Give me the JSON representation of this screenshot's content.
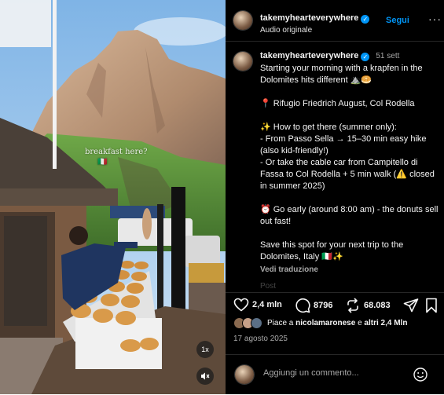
{
  "media": {
    "overlay_line1": "breakfast here?",
    "overlay_line2": "🇮🇹",
    "speed_label": "1x"
  },
  "header": {
    "username": "takemyhearteverywhere",
    "subtitle": "Audio originale",
    "follow_label": "Segui",
    "more_label": "···"
  },
  "caption": {
    "username": "takemyhearteverywhere",
    "time": "51 sett",
    "lines": [
      "Starting your morning with a krapfen in the Dolomites hits different ⛰️🥯",
      "",
      "📍 Rifugio Friedrich August, Col Rodella",
      "",
      "✨ How to get there (summer only):",
      "- From Passo Sella → 15–30 min easy hike (also kid-friendly!)",
      "- Or take the cable car from Campitello di Fassa to Col Rodella + 5 min walk (⚠️ closed in summer 2025)",
      "",
      "⏰ Go early (around 8:00 am) - the donuts sell out fast!",
      "",
      "Save this spot for your next trip to the Dolomites, Italy 🇮🇹✨"
    ],
    "translate_label": "Vedi traduzione",
    "next_faded": "Post"
  },
  "actions": {
    "likes": "2,4 mln",
    "comments": "8796",
    "reposts": "68.083"
  },
  "liked_by": {
    "prefix": "Piace a ",
    "user": "nicolamaronese",
    "middle": " e ",
    "others": "altri 2,4 Mln"
  },
  "date": "17 agosto 2025",
  "comment": {
    "placeholder": "Aggiungi un commento..."
  },
  "colors": {
    "accent": "#0095f6",
    "panel_bg": "#000000",
    "muted": "#a8a8a8"
  }
}
